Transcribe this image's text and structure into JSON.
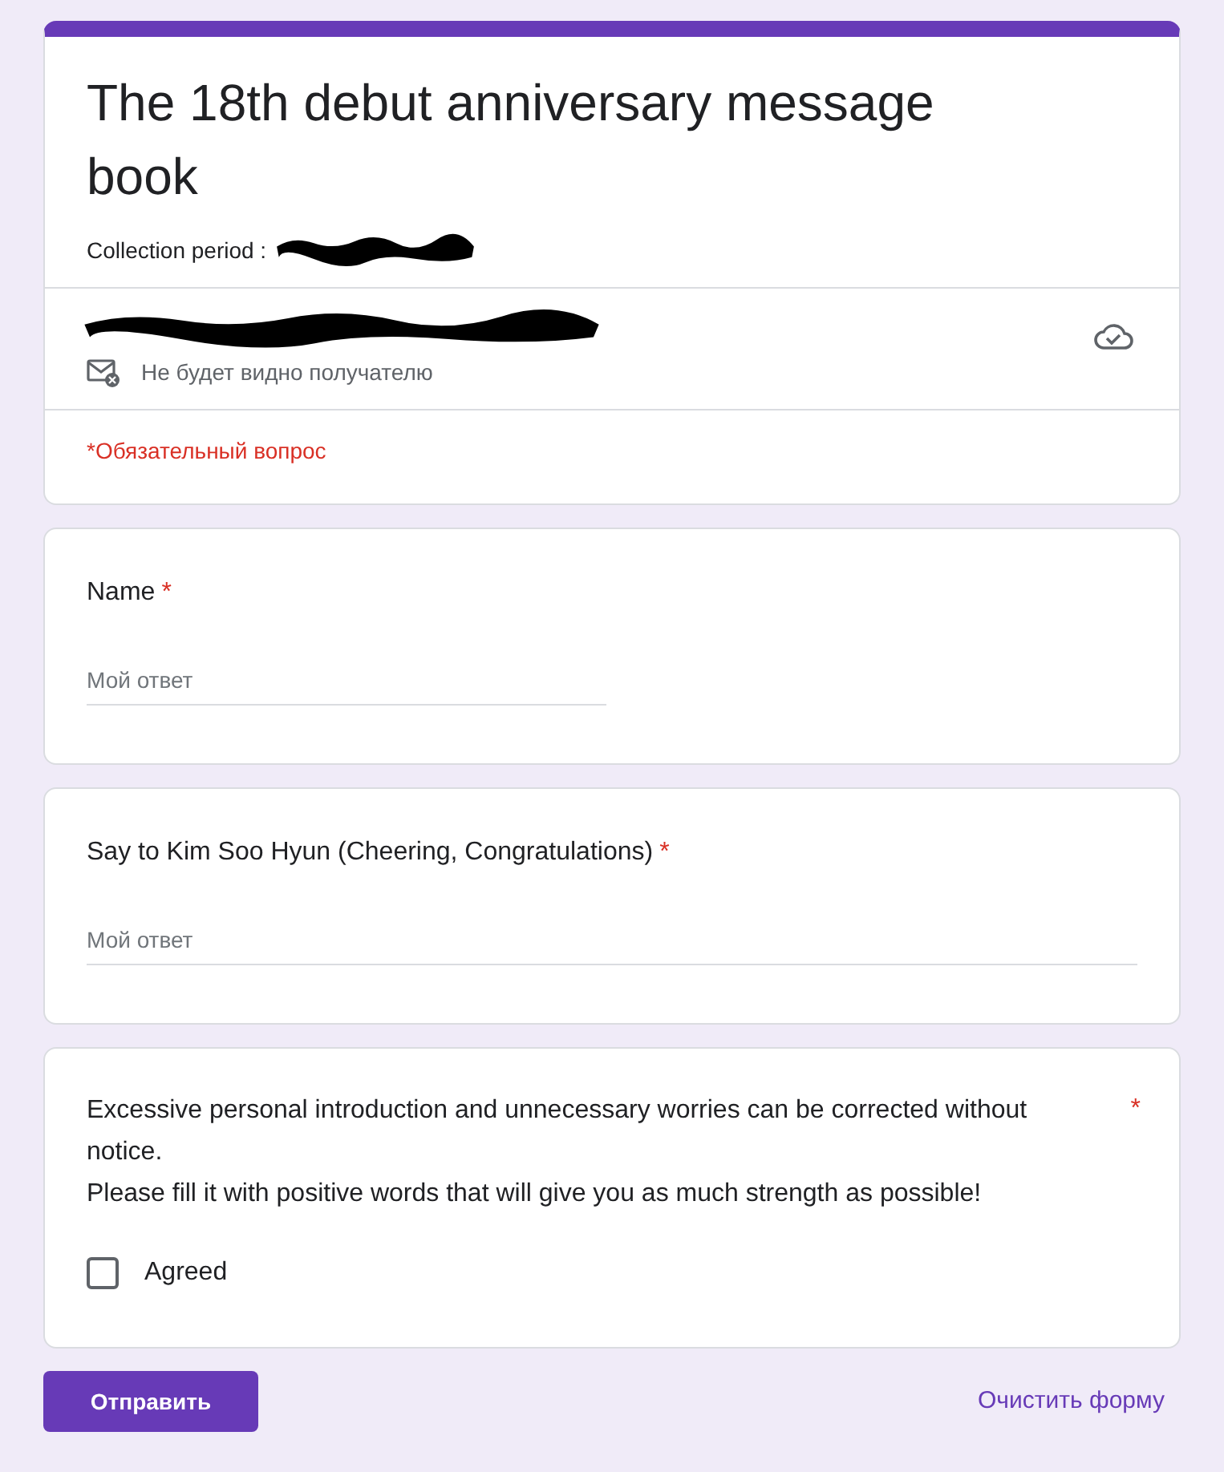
{
  "header": {
    "title": "The 18th debut anniversary message book",
    "description": "Collection period :",
    "privacy_note": "Не будет видно получателю",
    "required_note": "*Обязательный вопрос"
  },
  "questions": [
    {
      "kind": "text",
      "title": "Name",
      "required_mark": "*",
      "placeholder": "Мой ответ",
      "wide": false
    },
    {
      "kind": "text",
      "title": "Say to Kim Soo Hyun (Cheering, Congratulations)",
      "required_mark": "*",
      "placeholder": "Мой ответ",
      "wide": true
    },
    {
      "kind": "checkbox",
      "title_lines": [
        "Excessive personal introduction and unnecessary worries can be corrected without notice.",
        "Please fill it with positive words that will give you as much strength as possible!"
      ],
      "required_mark": "*",
      "options": [
        {
          "label": "Agreed",
          "checked": false
        }
      ]
    }
  ],
  "actions": {
    "submit": "Отправить",
    "clear": "Очистить форму"
  }
}
